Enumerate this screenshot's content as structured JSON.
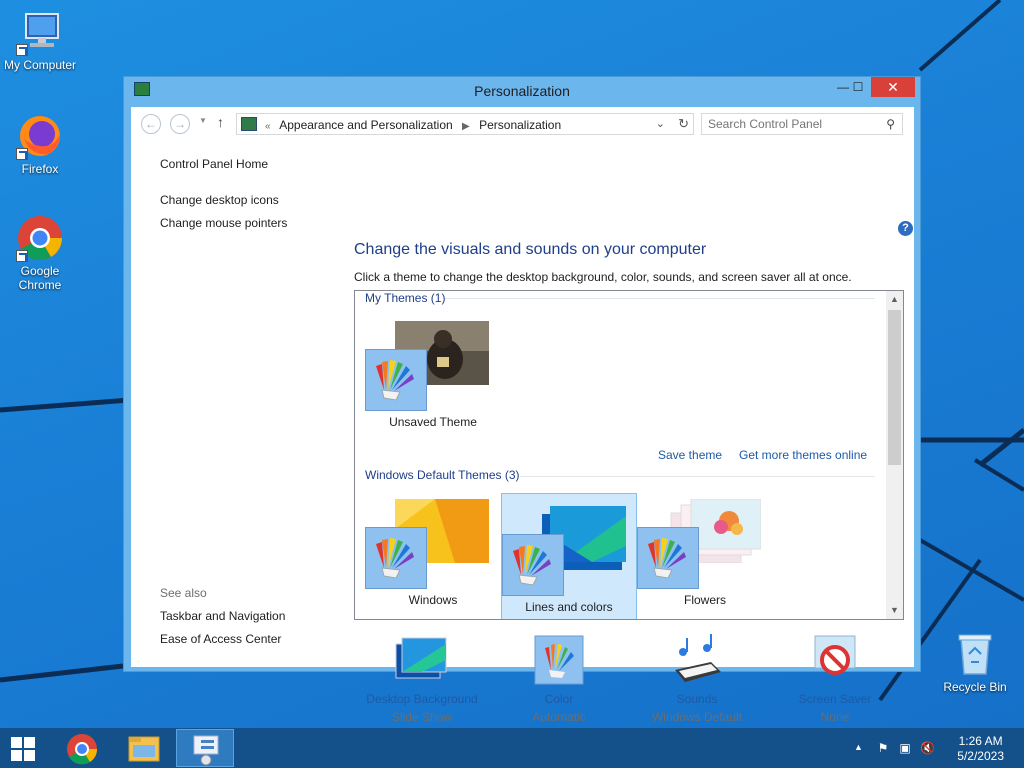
{
  "desktop": {
    "icons": [
      {
        "label": "My Computer",
        "icon": "computer-icon"
      },
      {
        "label": "Firefox",
        "icon": "firefox-icon"
      },
      {
        "label": "Google Chrome",
        "icon": "chrome-icon"
      },
      {
        "label": "Recycle Bin",
        "icon": "recycle-bin-icon"
      }
    ]
  },
  "window": {
    "title": "Personalization",
    "minimize": "—",
    "maximize": "☐",
    "close": "✕"
  },
  "navbar": {
    "back": "←",
    "forward": "→",
    "up": "↑",
    "breadcrumb_root": "«",
    "breadcrumb": [
      "Appearance and Personalization",
      "Personalization"
    ],
    "search_placeholder": "Search Control Panel"
  },
  "leftpane": {
    "home": "Control Panel Home",
    "links": [
      "Change desktop icons",
      "Change mouse pointers"
    ],
    "see_also_label": "See also",
    "see_also": [
      "Taskbar and Navigation",
      "Ease of Access Center"
    ]
  },
  "main": {
    "heading": "Change the visuals and sounds on your computer",
    "subheading": "Click a theme to change the desktop background, color, sounds, and screen saver all at once.",
    "my_themes_label": "My Themes (1)",
    "my_themes": [
      {
        "name": "Unsaved Theme"
      }
    ],
    "save_theme": "Save theme",
    "get_more": "Get more themes online",
    "default_themes_label": "Windows Default Themes (3)",
    "default_themes": [
      {
        "name": "Windows",
        "selected": false
      },
      {
        "name": "Lines and colors",
        "selected": true
      },
      {
        "name": "Flowers",
        "selected": false
      }
    ]
  },
  "options": [
    {
      "label": "Desktop Background",
      "value": "Slide Show",
      "icon": "desktop-background-icon"
    },
    {
      "label": "Color",
      "value": "Automatic",
      "icon": "color-icon"
    },
    {
      "label": "Sounds",
      "value": "Windows Default",
      "icon": "sounds-icon"
    },
    {
      "label": "Screen Saver",
      "value": "None",
      "icon": "screen-saver-icon"
    }
  ],
  "taskbar": {
    "time": "1:26 AM",
    "date": "5/2/2023",
    "tray_chevron": "▲"
  },
  "colors": {
    "desktop": "#1a7fd6",
    "window_frame": "#6cb6ee",
    "close_button": "#d9403a",
    "link": "#1e5aa8",
    "heading": "#1e3f8a",
    "taskbar": "#14508a"
  }
}
